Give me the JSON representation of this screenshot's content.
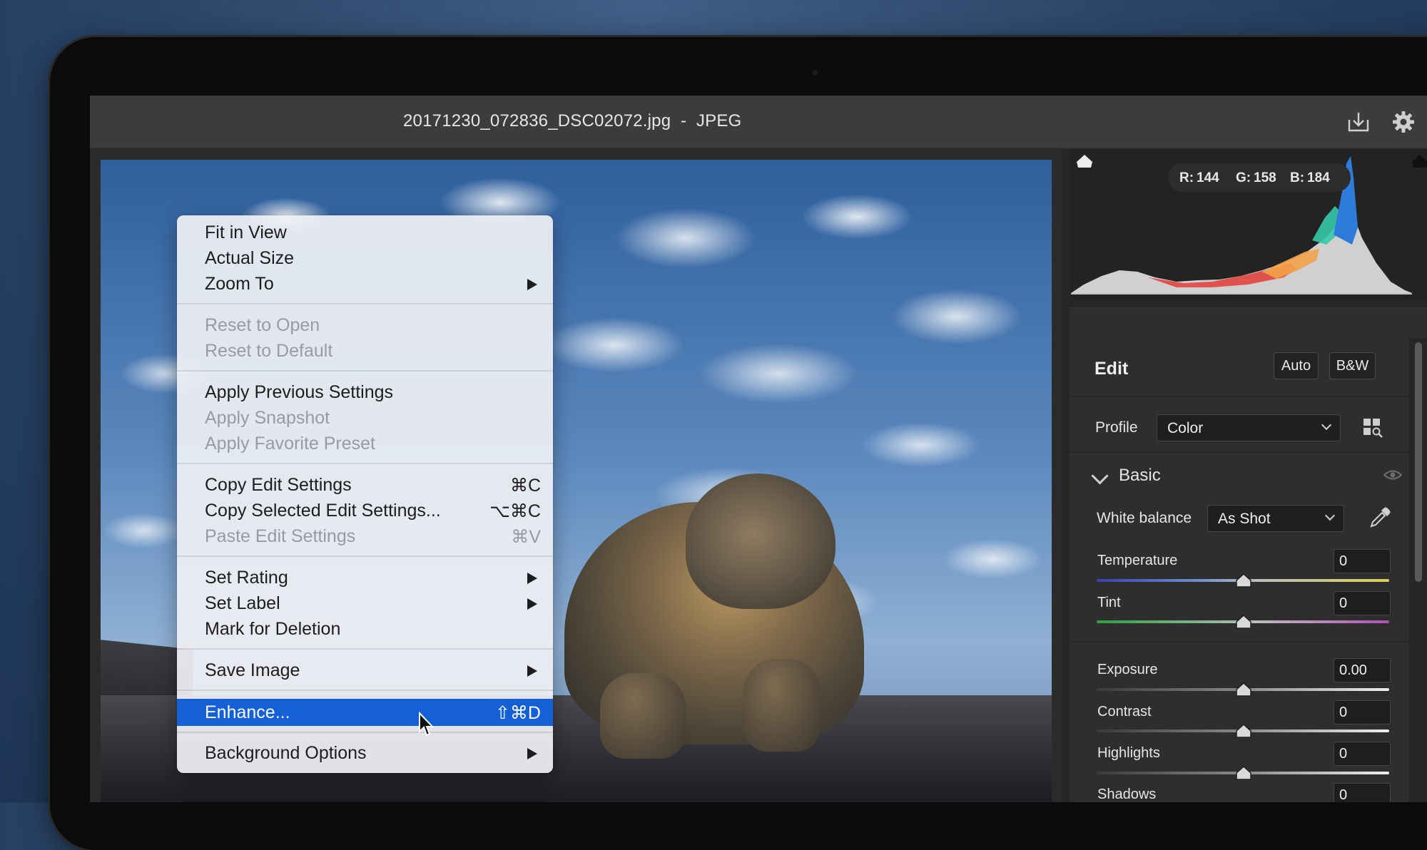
{
  "window": {
    "title": "20171230_072836_DSC02072.jpg  -  JPEG"
  },
  "icons": {
    "save": "save-icon",
    "settings": "gear-icon",
    "visibility": "eye-icon",
    "eyedropper": "eyedropper-icon",
    "profile_browser": "profile-browser-icon"
  },
  "context_menu": {
    "groups": [
      [
        {
          "label": "Fit in View",
          "enabled": true
        },
        {
          "label": "Actual Size",
          "enabled": true
        },
        {
          "label": "Zoom To",
          "enabled": true,
          "submenu": true
        }
      ],
      [
        {
          "label": "Reset to Open",
          "enabled": false
        },
        {
          "label": "Reset to Default",
          "enabled": false
        }
      ],
      [
        {
          "label": "Apply Previous Settings",
          "enabled": true
        },
        {
          "label": "Apply Snapshot",
          "enabled": false
        },
        {
          "label": "Apply Favorite Preset",
          "enabled": false
        }
      ],
      [
        {
          "label": "Copy Edit Settings",
          "shortcut": "⌘C",
          "enabled": true
        },
        {
          "label": "Copy Selected Edit Settings...",
          "shortcut": "⌥⌘C",
          "enabled": true
        },
        {
          "label": "Paste Edit Settings",
          "shortcut": "⌘V",
          "enabled": false
        }
      ],
      [
        {
          "label": "Set Rating",
          "enabled": true,
          "submenu": true
        },
        {
          "label": "Set Label",
          "enabled": true,
          "submenu": true
        },
        {
          "label": "Mark for Deletion",
          "enabled": true
        }
      ],
      [
        {
          "label": "Save Image",
          "enabled": true,
          "submenu": true
        }
      ],
      [
        {
          "label": "Enhance...",
          "shortcut": "⇧⌘D",
          "enabled": true,
          "highlighted": true
        }
      ],
      [
        {
          "label": "Background Options",
          "enabled": true,
          "submenu": true
        }
      ]
    ]
  },
  "histogram": {
    "r_label": "R:",
    "r_value": "144",
    "g_label": "G:",
    "g_value": "158",
    "b_label": "B:",
    "b_value": "184"
  },
  "edit_panel": {
    "title": "Edit",
    "auto_label": "Auto",
    "bw_label": "B&W",
    "profile_label": "Profile",
    "profile_value": "Color",
    "basic_label": "Basic",
    "white_balance_label": "White balance",
    "white_balance_value": "As Shot",
    "sliders": [
      {
        "label": "Temperature",
        "value": "0"
      },
      {
        "label": "Tint",
        "value": "0"
      },
      {
        "label": "Exposure",
        "value": "0.00"
      },
      {
        "label": "Contrast",
        "value": "0"
      },
      {
        "label": "Highlights",
        "value": "0"
      },
      {
        "label": "Shadows",
        "value": "0"
      }
    ]
  },
  "colors": {
    "menu_highlight": "#1460d6",
    "panel_bg": "#2e2e2e",
    "titlebar_bg": "#3c3c3c"
  }
}
